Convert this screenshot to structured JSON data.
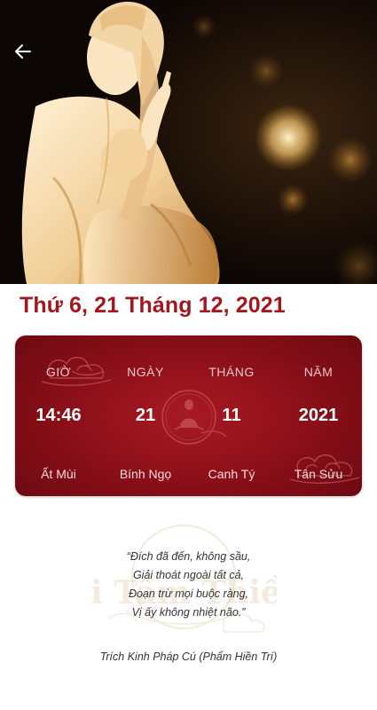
{
  "header": {
    "back_icon": "arrow-left-icon",
    "hero_image": "guanyin-statue-photo"
  },
  "date_title": "Thứ 6, 21 Tháng 12, 2021",
  "calendar": {
    "columns": [
      {
        "label": "GIỜ",
        "value": "14:46",
        "sub": "Ất Mùi"
      },
      {
        "label": "NGÀY",
        "value": "21",
        "sub": "Bính Ngọ"
      },
      {
        "label": "THÁNG",
        "value": "11",
        "sub": "Canh Tý"
      },
      {
        "label": "NĂM",
        "value": "2021",
        "sub": "Tân Sửu"
      }
    ],
    "colors": {
      "card": "#8a0f18",
      "title": "#a2171f"
    }
  },
  "quote": {
    "lines": [
      "“Đích đã đến, không sầu,",
      "Giải thoát ngoài tất cả,",
      "Đoạn trừ mọi buộc ràng,",
      "Vị ấy không nhiệt não.”"
    ],
    "source": "Trích Kinh Pháp Cú (Phẩm Hiền Trí)",
    "watermark_text": "Di Tâm Thiền"
  }
}
